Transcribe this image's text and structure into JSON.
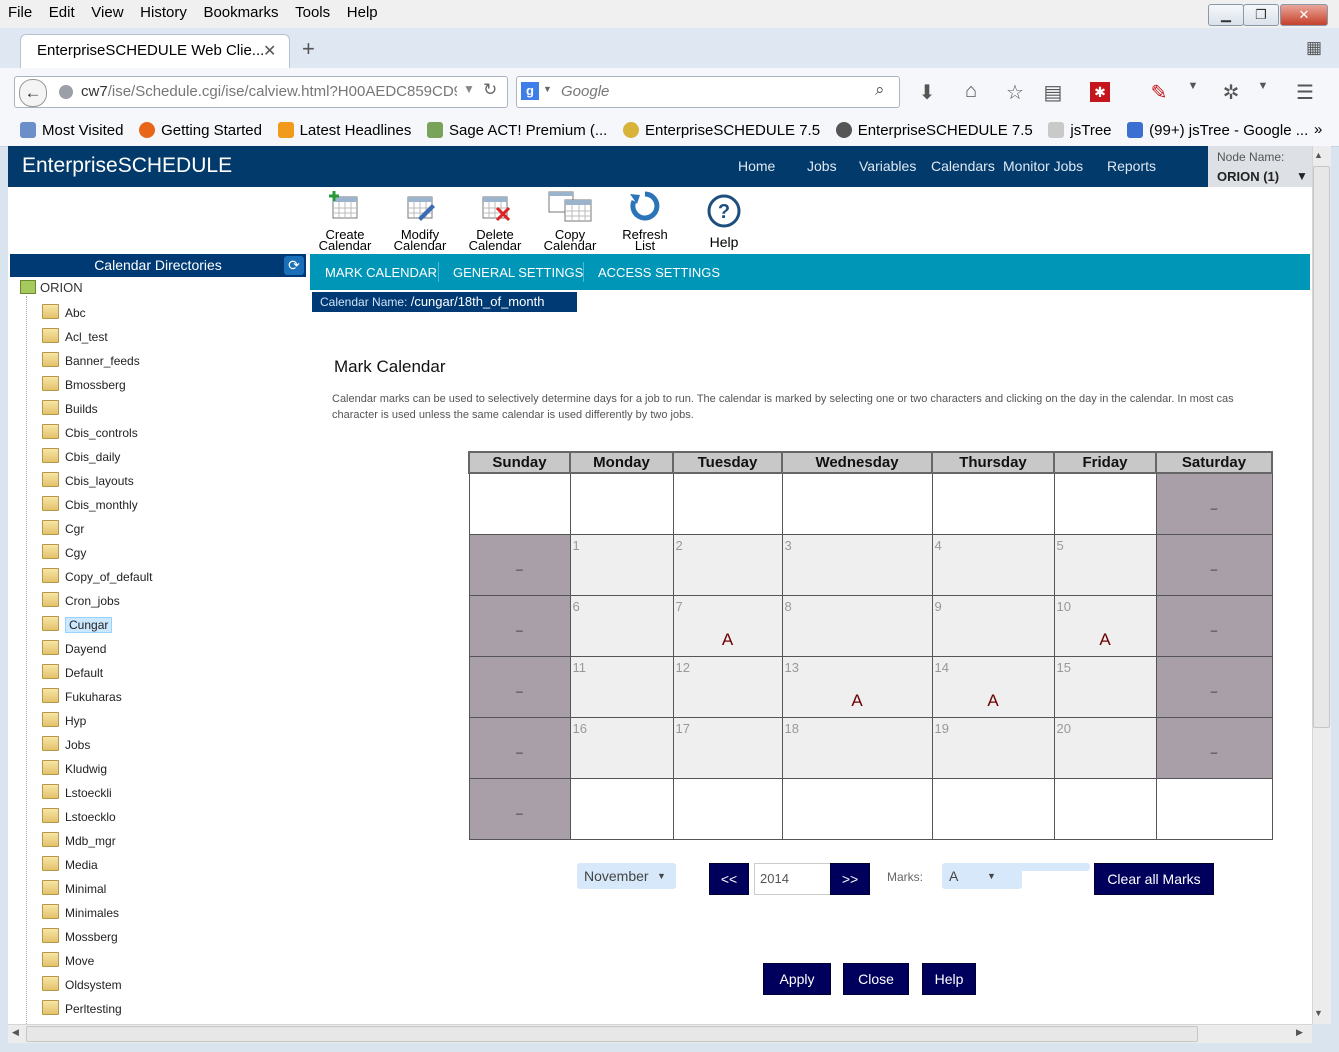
{
  "browser": {
    "menu": [
      "File",
      "Edit",
      "View",
      "History",
      "Bookmarks",
      "Tools",
      "Help"
    ],
    "tab_title": "EnterpriseSCHEDULE Web Clie...",
    "url_host": "cw7",
    "url_path": "/ise/Schedule.cgi/ise/calview.html?H00AEDC859CD9",
    "search_placeholder": "Google",
    "bookmarks": [
      "Most Visited",
      "Getting Started",
      "Latest Headlines",
      "Sage ACT! Premium (...",
      "EnterpriseSCHEDULE 7.5",
      "EnterpriseSCHEDULE 7.5",
      "jsTree",
      "(99+) jsTree - Google ..."
    ],
    "bookmark_overflow": "»"
  },
  "app": {
    "title": "EnterpriseSCHEDULE",
    "nav": [
      "Home",
      "Jobs",
      "Variables",
      "Calendars",
      "Monitor Jobs",
      "Reports"
    ],
    "node_label": "Node Name:",
    "node_value": "ORION (1)"
  },
  "toolbar": [
    {
      "l1": "Create",
      "l2": "Calendar",
      "icon": "create-calendar-icon"
    },
    {
      "l1": "Modify",
      "l2": "Calendar",
      "icon": "modify-calendar-icon"
    },
    {
      "l1": "Delete",
      "l2": "Calendar",
      "icon": "delete-calendar-icon"
    },
    {
      "l1": "Copy",
      "l2": "Calendar",
      "icon": "copy-calendar-icon"
    },
    {
      "l1": "Refresh",
      "l2": "List",
      "icon": "refresh-icon"
    },
    {
      "l1": "Help",
      "l2": "",
      "icon": "help-icon"
    }
  ],
  "tree": {
    "header": "Calendar Directories",
    "root": "ORION",
    "items": [
      "Abc",
      "Acl_test",
      "Banner_feeds",
      "Bmossberg",
      "Builds",
      "Cbis_controls",
      "Cbis_daily",
      "Cbis_layouts",
      "Cbis_monthly",
      "Cgr",
      "Cgy",
      "Copy_of_default",
      "Cron_jobs",
      "Cungar",
      "Dayend",
      "Default",
      "Fukuharas",
      "Hyp",
      "Jobs",
      "Kludwig",
      "Lstoeckli",
      "Lstoecklo",
      "Mdb_mgr",
      "Media",
      "Minimal",
      "Minimales",
      "Mossberg",
      "Move",
      "Oldsystem",
      "Perltesting"
    ],
    "selected": "Cungar"
  },
  "subtabs": [
    "MARK CALENDAR",
    "GENERAL SETTINGS",
    "ACCESS SETTINGS"
  ],
  "calendar_name_label": "Calendar Name:",
  "calendar_name": "/cungar/18th_of_month",
  "mark": {
    "heading": "Mark Calendar",
    "description_line1": "Calendar marks can be used to selectively determine days for a job to run. The calendar is marked by selecting one or two characters and clicking on the day in the calendar. In most cas",
    "description_line2": "character is used unless the same calendar is used differently by two jobs."
  },
  "calendar": {
    "days": [
      "Sunday",
      "Monday",
      "Tuesday",
      "Wednesday",
      "Thursday",
      "Friday",
      "Saturday"
    ],
    "weekend_mark": "–",
    "weeks": [
      [
        {
          "t": "blank"
        },
        {
          "t": "blank"
        },
        {
          "t": "blank"
        },
        {
          "t": "blank"
        },
        {
          "t": "blank"
        },
        {
          "t": "blank"
        },
        {
          "t": "wk"
        }
      ],
      [
        {
          "t": "wk"
        },
        {
          "t": "day",
          "n": "1"
        },
        {
          "t": "day",
          "n": "2"
        },
        {
          "t": "day",
          "n": "3"
        },
        {
          "t": "day",
          "n": "4"
        },
        {
          "t": "day",
          "n": "5"
        },
        {
          "t": "wk"
        }
      ],
      [
        {
          "t": "wk"
        },
        {
          "t": "day",
          "n": "6"
        },
        {
          "t": "day",
          "n": "7",
          "m": "A"
        },
        {
          "t": "day",
          "n": "8"
        },
        {
          "t": "day",
          "n": "9"
        },
        {
          "t": "day",
          "n": "10",
          "m": "A"
        },
        {
          "t": "wk"
        }
      ],
      [
        {
          "t": "wk"
        },
        {
          "t": "day",
          "n": "11"
        },
        {
          "t": "day",
          "n": "12"
        },
        {
          "t": "day",
          "n": "13",
          "m": "A"
        },
        {
          "t": "day",
          "n": "14",
          "m": "A"
        },
        {
          "t": "day",
          "n": "15"
        },
        {
          "t": "wk"
        }
      ],
      [
        {
          "t": "wk"
        },
        {
          "t": "day",
          "n": "16"
        },
        {
          "t": "day",
          "n": "17"
        },
        {
          "t": "day",
          "n": "18"
        },
        {
          "t": "day",
          "n": "19"
        },
        {
          "t": "day",
          "n": "20"
        },
        {
          "t": "wk"
        }
      ],
      [
        {
          "t": "wk"
        },
        {
          "t": "blank"
        },
        {
          "t": "blank"
        },
        {
          "t": "blank"
        },
        {
          "t": "blank"
        },
        {
          "t": "blank"
        },
        {
          "t": "blank"
        }
      ]
    ]
  },
  "controls": {
    "month": "November",
    "prev": "<<",
    "year": "2014",
    "next": ">>",
    "marks_label": "Marks:",
    "mark_value": "A",
    "clear": "Clear all Marks"
  },
  "footer_buttons": [
    "Apply",
    "Close",
    "Help"
  ]
}
